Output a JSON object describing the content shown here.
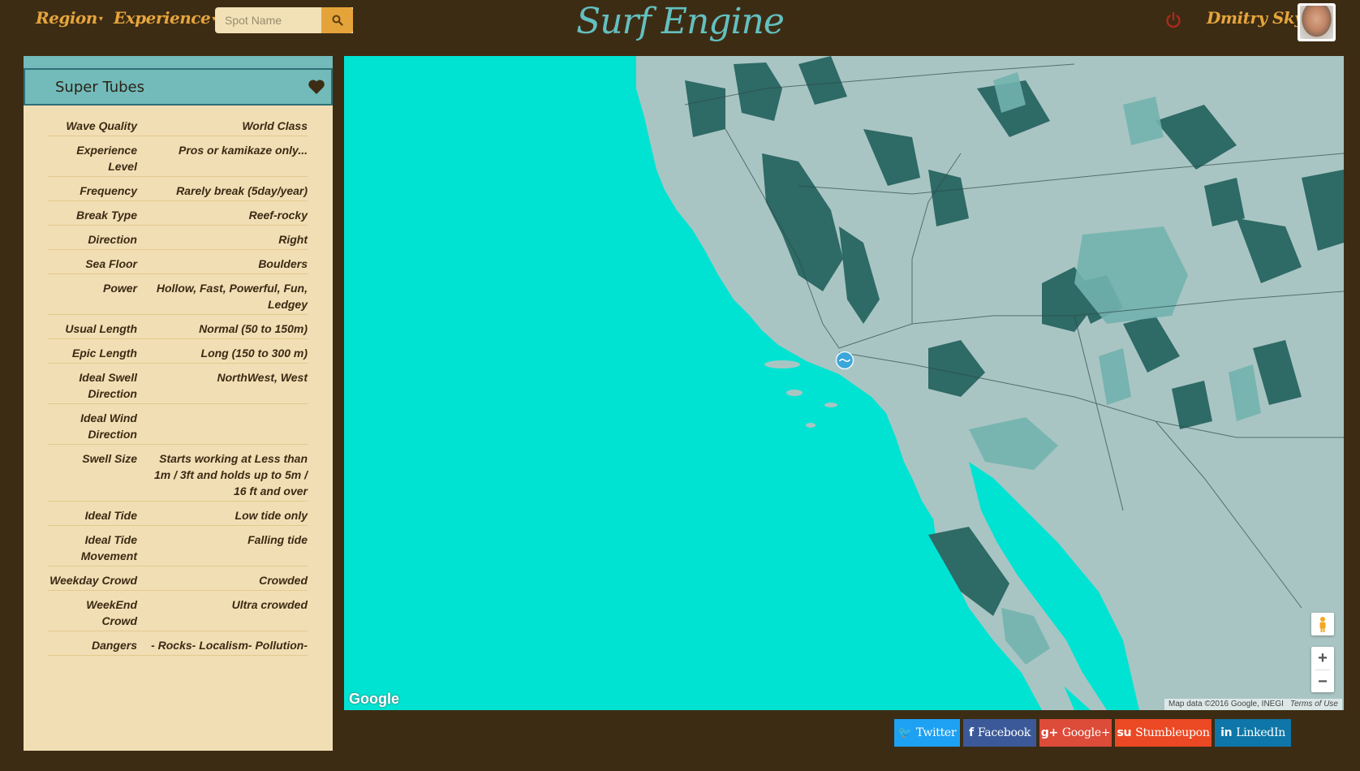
{
  "nav": {
    "region_label": "Region",
    "experience_label": "Experience",
    "search_placeholder": "Spot Name",
    "brand": "Surf Engine",
    "user_name": "Dmitry Sky"
  },
  "spot": {
    "title": "Super Tubes",
    "attributes": [
      {
        "label": "Wave Quality",
        "value": "World Class"
      },
      {
        "label": "Experience Level",
        "value": "Pros or kamikaze only..."
      },
      {
        "label": "Frequency",
        "value": "Rarely break (5day/year)"
      },
      {
        "label": "Break Type",
        "value": "Reef-rocky"
      },
      {
        "label": "Direction",
        "value": "Right"
      },
      {
        "label": "Sea Floor",
        "value": "Boulders"
      },
      {
        "label": "Power",
        "value": "Hollow, Fast, Powerful, Fun, Ledgey"
      },
      {
        "label": "Usual Length",
        "value": "Normal (50 to 150m)"
      },
      {
        "label": "Epic Length",
        "value": "Long (150 to 300 m)"
      },
      {
        "label": "Ideal Swell Direction",
        "value": "NorthWest, West"
      },
      {
        "label": "Ideal Wind Direction",
        "value": ""
      },
      {
        "label": "Swell Size",
        "value": "Starts working at Less than 1m / 3ft and holds up to 5m / 16 ft and over"
      },
      {
        "label": "Ideal Tide",
        "value": "Low tide only"
      },
      {
        "label": "Ideal Tide Movement",
        "value": "Falling tide"
      },
      {
        "label": "Weekday Crowd",
        "value": "Crowded"
      },
      {
        "label": "WeekEnd Crowd",
        "value": "Ultra crowded"
      },
      {
        "label": "Dangers",
        "value": "- Rocks- Localism- Pollution-"
      }
    ]
  },
  "map": {
    "logo": "Google",
    "attribution": "Map data ©2016 Google, INEGI",
    "terms": "Terms of Use",
    "zoom_in": "+",
    "zoom_out": "−",
    "colors": {
      "water": "#00e3d3",
      "land": "#a9c5c3",
      "forest": "#2e6a66",
      "park": "#72b2ae"
    }
  },
  "share": [
    {
      "key": "twitter",
      "icon": "twitter-icon",
      "label": "Twitter",
      "color": "#1da1f2"
    },
    {
      "key": "facebook",
      "icon": "facebook-icon",
      "label": "Facebook",
      "color": "#3b5998"
    },
    {
      "key": "googleplus",
      "icon": "google-plus-icon",
      "label": "Google+",
      "color": "#dd4b39"
    },
    {
      "key": "stumbleupon",
      "icon": "stumbleupon-icon",
      "label": "Stumbleupon",
      "color": "#eb4924"
    },
    {
      "key": "linkedin",
      "icon": "linkedin-icon",
      "label": "LinkedIn",
      "color": "#0e76a8"
    }
  ]
}
